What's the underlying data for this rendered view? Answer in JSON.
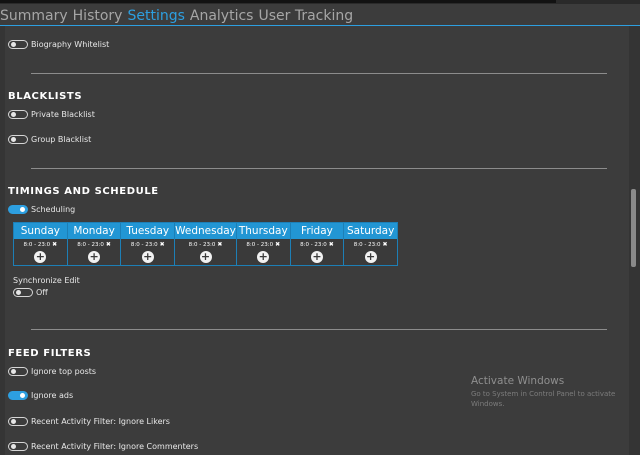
{
  "tabs": [
    {
      "label": "Summary",
      "active": false
    },
    {
      "label": "History",
      "active": false
    },
    {
      "label": "Settings",
      "active": true
    },
    {
      "label": "Analytics",
      "active": false
    },
    {
      "label": "User Tracking",
      "active": false
    }
  ],
  "colors": {
    "accent": "#2d9fe0",
    "background": "#3c3c3c"
  },
  "settings": {
    "biography_whitelist": {
      "label": "Biography Whitelist",
      "on": false
    },
    "blacklists": {
      "heading": "BLACKLISTS",
      "private": {
        "label": "Private Blacklist",
        "on": false
      },
      "group": {
        "label": "Group Blacklist",
        "on": false
      }
    },
    "timings": {
      "heading": "TIMINGS AND SCHEDULE",
      "scheduling": {
        "label": "Scheduling",
        "on": true
      },
      "days": [
        {
          "name": "Sunday",
          "time": "8:0 - 23:0"
        },
        {
          "name": "Monday",
          "time": "8:0 - 23:0"
        },
        {
          "name": "Tuesday",
          "time": "8:0 - 23:0"
        },
        {
          "name": "Wednesday",
          "time": "8:0 - 23:0"
        },
        {
          "name": "Thursday",
          "time": "8:0 - 23:0"
        },
        {
          "name": "Friday",
          "time": "8:0 - 23:0"
        },
        {
          "name": "Saturday",
          "time": "8:0 - 23:0"
        }
      ],
      "remove_glyph": "✖",
      "add_glyph": "+",
      "sync_edit_label": "Synchronize Edit",
      "sync_edit": {
        "label": "Off",
        "on": false
      }
    },
    "feed_filters": {
      "heading": "FEED FILTERS",
      "ignore_top_posts": {
        "label": "Ignore top posts",
        "on": false
      },
      "ignore_ads": {
        "label": "Ignore ads",
        "on": true
      },
      "ignore_likers": {
        "label": "Recent Activity Filter: Ignore Likers",
        "on": false
      },
      "ignore_commenters": {
        "label": "Recent Activity Filter: Ignore Commenters",
        "on": false
      }
    }
  },
  "watermark": {
    "title": "Activate Windows",
    "subtitle": "Go to System in Control Panel to activate Windows."
  }
}
